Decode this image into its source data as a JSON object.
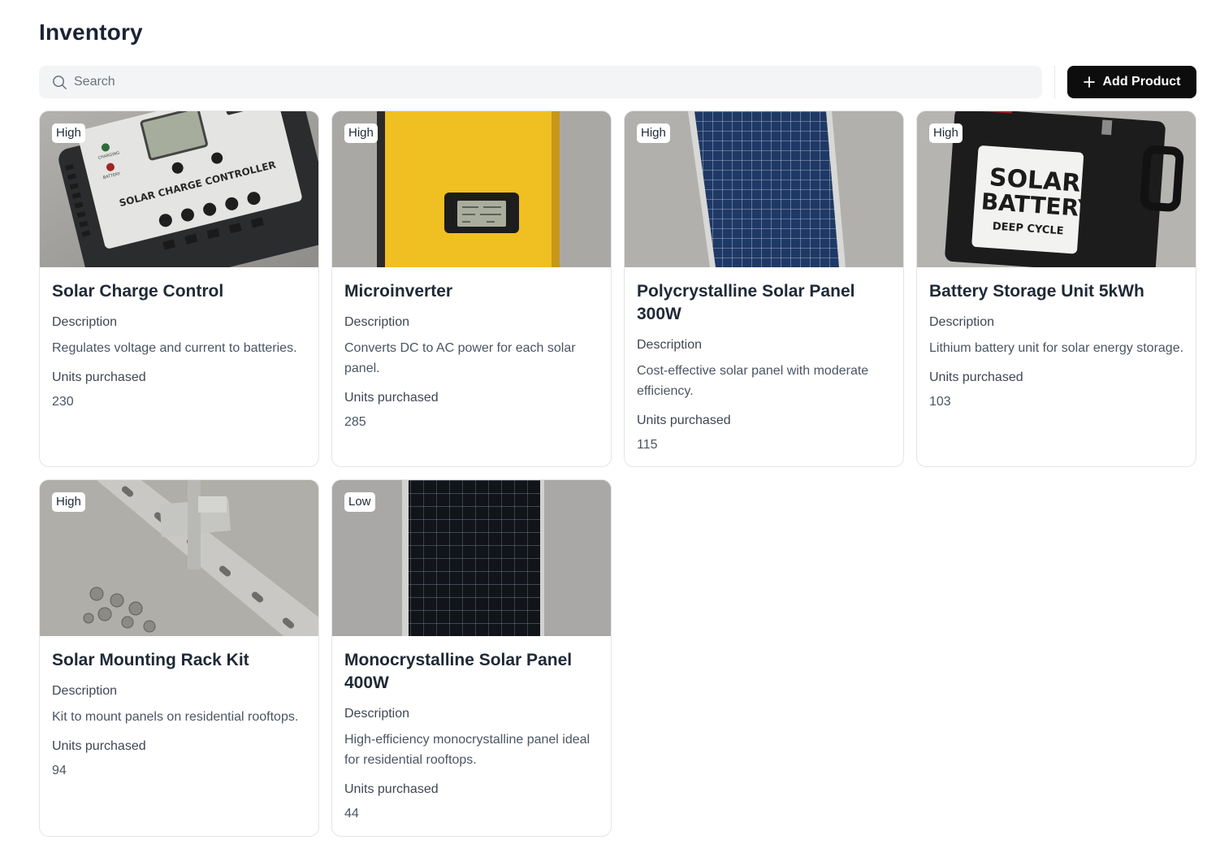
{
  "page": {
    "title": "Inventory"
  },
  "search": {
    "placeholder": "Search"
  },
  "toolbar": {
    "add_label": "Add Product"
  },
  "labels": {
    "description": "Description",
    "units": "Units purchased"
  },
  "products": [
    {
      "name": "Solar Charge Control",
      "badge": "High",
      "description": "Regulates voltage and current to batteries.",
      "units": "230",
      "image": "charge-controller"
    },
    {
      "name": "Microinverter",
      "badge": "High",
      "description": "Converts DC to AC power for each solar panel.",
      "units": "285",
      "image": "microinverter"
    },
    {
      "name": "Polycrystalline Solar Panel 300W",
      "badge": "High",
      "description": "Cost-effective solar panel with moderate efficiency.",
      "units": "115",
      "image": "polycrystalline-panel"
    },
    {
      "name": "Battery Storage Unit 5kWh",
      "badge": "High",
      "description": "Lithium battery unit for solar energy storage.",
      "units": "103",
      "image": "battery"
    },
    {
      "name": "Solar Mounting Rack Kit",
      "badge": "High",
      "description": "Kit to mount panels on residential rooftops.",
      "units": "94",
      "image": "mounting-rack"
    },
    {
      "name": "Monocrystalline Solar Panel 400W",
      "badge": "Low",
      "description": "High-efficiency monocrystalline panel ideal for residential rooftops.",
      "units": "44",
      "image": "monocrystalline-panel"
    }
  ],
  "image_text": {
    "controller_label": "SOLAR CHARGE CONTROLLER",
    "controller_charging": "CHARGING",
    "controller_battery": "BATTERY",
    "battery_line1": "SOLAR",
    "battery_line2": "BATTERY",
    "battery_line3": "DEEP CYCLE"
  }
}
